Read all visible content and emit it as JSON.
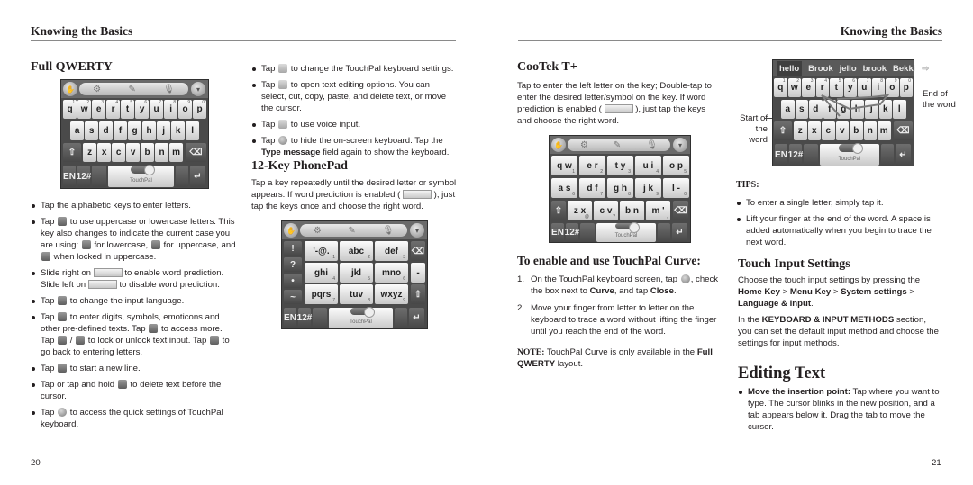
{
  "left_page": {
    "running_head": "Knowing the Basics",
    "page_number": "20",
    "full_qwerty": {
      "heading": "Full QWERTY",
      "keyboard_image": {
        "toolbar_icons": [
          "touchpal-logo-icon",
          "gear-icon",
          "edit-icon",
          "microphone-icon",
          "hide-keyboard-icon"
        ],
        "row1": [
          {
            "k": "q",
            "n": "1"
          },
          {
            "k": "w",
            "n": "2"
          },
          {
            "k": "e",
            "n": "3"
          },
          {
            "k": "r",
            "n": "4"
          },
          {
            "k": "t",
            "n": "5"
          },
          {
            "k": "y",
            "n": "6"
          },
          {
            "k": "u",
            "n": "7"
          },
          {
            "k": "i",
            "n": "8"
          },
          {
            "k": "o",
            "n": "9"
          },
          {
            "k": "p",
            "n": "0"
          }
        ],
        "row2": [
          "a",
          "s",
          "d",
          "f",
          "g",
          "h",
          "j",
          "k",
          "l"
        ],
        "row3": [
          "z",
          "x",
          "c",
          "v",
          "b",
          "n",
          "m"
        ],
        "row4": {
          "lang": "EN",
          "sym": "12#",
          "space": "TouchPal"
        }
      },
      "bullets": [
        {
          "text": "Tap the alphabetic keys to enter letters."
        },
        {
          "parts": [
            "Tap ",
            "[shift-icon]",
            " to use uppercase or lowercase letters. This key also changes to indicate the current case you are using: ",
            "[lowercase-icon]",
            " for lowercase, ",
            "[uppercase-icon]",
            " for uppercase, and ",
            "[capslock-icon]",
            " when locked in uppercase."
          ]
        },
        {
          "parts": [
            "Slide right on ",
            "[prediction-switch-off]",
            " to enable word prediction. Slide left on ",
            "[prediction-switch-on]",
            " to disable word prediction."
          ]
        },
        {
          "parts": [
            "Tap ",
            "[language-icon]",
            " to change the input language."
          ]
        },
        {
          "parts": [
            "Tap ",
            "[symbols-icon]",
            " to enter digits, symbols, emoticons and other pre-defined texts. Tap ",
            "[more-icon]",
            " to access more. Tap ",
            "[lock-icon]",
            " / ",
            "[unlock-icon]",
            " to lock or unlock text input. Tap ",
            "[back-icon]",
            " to go back to entering letters."
          ]
        },
        {
          "parts": [
            "Tap ",
            "[enter-icon]",
            " to start a new line."
          ]
        },
        {
          "parts": [
            "Tap or tap and hold ",
            "[delete-icon]",
            " to delete text before the cursor."
          ]
        },
        {
          "parts": [
            "Tap ",
            "[touchpal-logo-icon]",
            " to access the quick settings of TouchPal keyboard."
          ]
        }
      ]
    },
    "right_column": {
      "bullets": [
        {
          "a": "Tap ",
          "b": " to change the TouchPal keyboard settings."
        },
        {
          "a": "Tap ",
          "b": " to open text editing options. You can select, cut, copy, paste, and delete text, or move the cursor."
        },
        {
          "a": "Tap ",
          "b": " to use voice input."
        },
        {
          "a": "Tap ",
          "b": " to hide the on-screen keyboard. Tap the ",
          "bold": "Type message",
          "c": " field again to show the keyboard."
        }
      ],
      "phonepad": {
        "heading": "12-Key PhonePad",
        "text_a": "Tap a key repeatedly until the desired letter or symbol appears. If word prediction is enabled ( ",
        "text_b": " ), just tap the keys once and choose the right word.",
        "keyboard_image": {
          "side_keys": [
            "!",
            "?",
            "•",
            "~"
          ],
          "grid": [
            {
              "k": "'-@.",
              "n": "1"
            },
            {
              "k": "abc",
              "n": "2"
            },
            {
              "k": "def",
              "n": "3"
            },
            {
              "k": "ghi",
              "n": "4"
            },
            {
              "k": "jkl",
              "n": "5"
            },
            {
              "k": "mno",
              "n": "6"
            },
            {
              "k": "pqrs",
              "n": "7"
            },
            {
              "k": "tuv",
              "n": "8"
            },
            {
              "k": "wxyz",
              "n": "9"
            }
          ],
          "right_keys": [
            "⌫",
            "-",
            "⇧"
          ],
          "bottom": {
            "lang": "EN",
            "sym": "12#",
            "space": "TouchPal"
          }
        }
      }
    }
  },
  "right_page": {
    "running_head": "Knowing the Basics",
    "page_number": "21",
    "cootek": {
      "heading": "CooTek T+",
      "text_a": "Tap to enter the left letter on the key; Double-tap to enter the desired letter/symbol on the key. If word prediction is enabled ( ",
      "text_b": " ), just tap the keys and choose the right word.",
      "keyboard_image": {
        "row1": [
          {
            "k": "q w",
            "n": "1"
          },
          {
            "k": "e r",
            "n": "2"
          },
          {
            "k": "t y",
            "n": "3"
          },
          {
            "k": "u i",
            "n": "4"
          },
          {
            "k": "o p",
            "n": "5"
          }
        ],
        "row2": [
          {
            "k": "a s",
            "n": "6"
          },
          {
            "k": "d f",
            "n": "7"
          },
          {
            "k": "g h",
            "n": "8"
          },
          {
            "k": "j k",
            "n": "9"
          },
          {
            "k": "l -",
            "n": "0"
          }
        ],
        "row3": [
          {
            "k": "z x",
            "n": "@"
          },
          {
            "k": "c v",
            "n": "?"
          },
          {
            "k": "b n",
            "n": "!"
          },
          {
            "k": "m '",
            "n": ","
          }
        ],
        "bottom": {
          "lang": "EN",
          "sym": "12#",
          "space": "TouchPal"
        }
      }
    },
    "curve": {
      "heading": "To enable and use TouchPal Curve:",
      "steps": [
        {
          "num": "1.",
          "a": "On the TouchPal keyboard screen, tap ",
          "b": ", check the box next to ",
          "b1": "Curve",
          "c": ", and tap ",
          "c1": "Close",
          "d": "."
        },
        {
          "num": "2.",
          "a": "Move your finger from letter to letter on the keyboard to trace a word without lifting the finger until you reach the end of the word."
        }
      ],
      "note_label": "NOTE:",
      "note_a": " TouchPal Curve is only available in the ",
      "note_bold": "Full QWERTY",
      "note_b": " layout."
    },
    "curve_image": {
      "suggestions": [
        "hello",
        "Brook",
        "jello",
        "brook",
        "Bekki"
      ],
      "start_label": "Start of the word",
      "end_label": "End of the word",
      "row1": [
        "q",
        "w",
        "e",
        "r",
        "t",
        "y",
        "u",
        "i",
        "o",
        "p"
      ],
      "row1_nums": [
        "1",
        "2",
        "3",
        "4",
        "5",
        "6",
        "7",
        "8",
        "9",
        "0"
      ],
      "row2": [
        "a",
        "s",
        "d",
        "f",
        "g",
        "h",
        "j",
        "k",
        "l"
      ],
      "row3": [
        "z",
        "x",
        "c",
        "v",
        "b",
        "n",
        "m"
      ],
      "bottom": {
        "lang": "EN",
        "sym": "12#",
        "space": "TouchPal"
      }
    },
    "tips": {
      "label": "TIPS:",
      "items": [
        "To enter a single letter, simply tap it.",
        "Lift your finger at the end of the word. A space is added automatically when you begin to trace the next word."
      ]
    },
    "touch_input": {
      "heading": "Touch Input Settings",
      "p1_a": "Choose the touch input settings by pressing the ",
      "p1_b1": "Home Key",
      "p1_sep1": " > ",
      "p1_b2": "Menu Key",
      "p1_sep2": " > ",
      "p1_b3": "System settings",
      "p1_sep3": " > ",
      "p1_b4": "Language & input",
      "p1_end": ".",
      "p2_a": "In the ",
      "p2_bold": "KEYBOARD & INPUT METHODS",
      "p2_b": " section, you can set the default input method and choose the settings for input methods."
    },
    "editing": {
      "heading": "Editing Text",
      "item_bold": "Move the insertion point:",
      "item_text": " Tap where you want to type. The cursor blinks in the new position, and a tab appears below it. Drag the tab to move the cursor."
    }
  }
}
